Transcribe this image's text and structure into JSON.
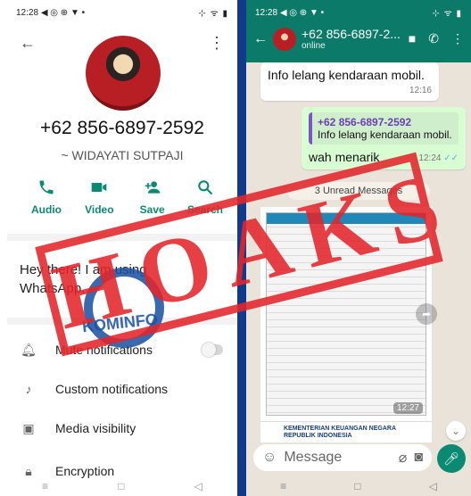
{
  "left": {
    "status": {
      "time": "12:28",
      "icons": "◀ ◎ ⊕ ▼ •",
      "right": "⊹ ᯤ ▮"
    },
    "profile": {
      "phone": "+62 856-6897-2592",
      "name": "~ WIDAYATI SUTPAJI"
    },
    "actions": [
      {
        "label": "Audio",
        "icon": "phone-icon"
      },
      {
        "label": "Video",
        "icon": "video-icon"
      },
      {
        "label": "Save",
        "icon": "add-person-icon"
      },
      {
        "label": "Search",
        "icon": "search-icon"
      }
    ],
    "about": "Hey there! I am using WhatsApp.",
    "settings": [
      {
        "label": "Mute notifications",
        "icon": "bell-icon"
      },
      {
        "label": "Custom notifications",
        "icon": "music-note-icon"
      },
      {
        "label": "Media visibility",
        "icon": "image-icon"
      },
      {
        "label": "Encryption",
        "icon": "lock-icon"
      }
    ],
    "nav": [
      "≡",
      "□",
      "◁"
    ]
  },
  "right": {
    "status": {
      "time": "12:28",
      "icons": "◀ ◎ ⊕ ▼ •",
      "right": "⊹ ᯤ ▮"
    },
    "header": {
      "title": "+62 856-6897-2...",
      "subtitle": "online"
    },
    "messages": {
      "first": {
        "text": "Info lelang kendaraan mobil.",
        "time": "12:16"
      },
      "reply": {
        "quote_name": "+62 856-6897-2592",
        "quote_text": "Info lelang kendaraan mobil.",
        "text": "wah menarik",
        "time": "12:24"
      }
    },
    "unread": "3 Unread Messages",
    "document": {
      "time": "12:27",
      "footer": "KEMENTERIAN KEUANGAN NEGARA REPUBLIK INDONESIA"
    },
    "composer": {
      "placeholder": "Message"
    },
    "nav": [
      "≡",
      "□",
      "◁"
    ]
  },
  "overlay": {
    "stamp": "HOAKS",
    "logo_text": "KOMINFO"
  },
  "colors": {
    "whatsapp_green": "#0b7a69",
    "accent": "#0b8a73",
    "stamp_red": "#e3262c",
    "divider": "#123a8c"
  }
}
